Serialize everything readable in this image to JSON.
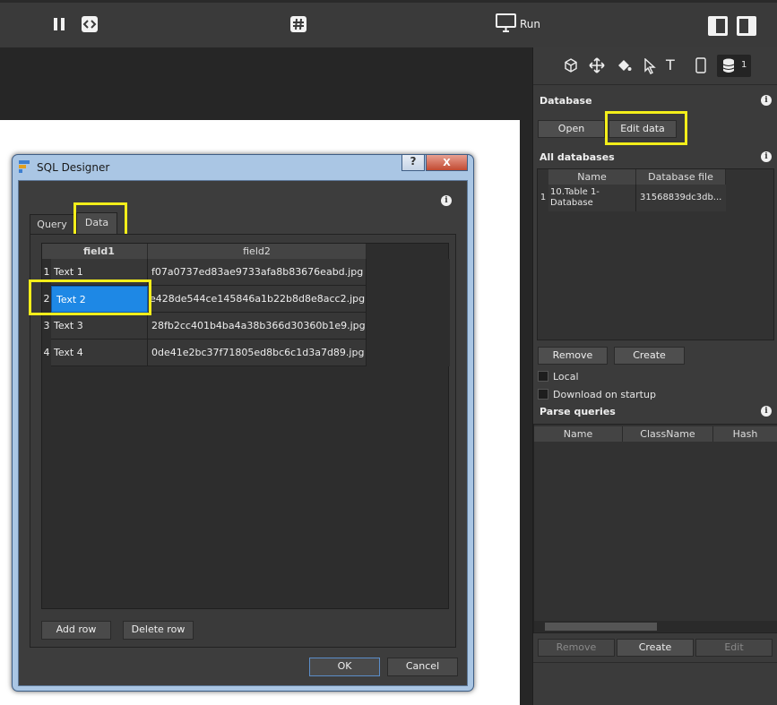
{
  "toolbar": {
    "pause_icon": "pause-icon",
    "code_icon": "code-icon",
    "hash_icon": "hash-icon",
    "run_label": "Run",
    "monitor_icon": "monitor-icon",
    "layout_left_icon": "layout-left-icon",
    "layout_right_icon": "layout-right-icon"
  },
  "panel": {
    "tools": [
      "cube-icon",
      "move-icon",
      "paint-bucket-icon",
      "pointer-icon",
      "text-icon",
      "phone-icon",
      "database-icon"
    ],
    "database_badge": "1",
    "database_title": "Database",
    "open_label": "Open",
    "edit_data_label": "Edit data",
    "all_databases_title": "All databases",
    "db_columns": [
      "Name",
      "Database file"
    ],
    "db_rows": [
      {
        "index": "1",
        "name": "10.Table 1-Database",
        "file": "31568839dc3db..."
      }
    ],
    "remove_label": "Remove",
    "create_label": "Create",
    "local_label": "Local",
    "download_label": "Download on startup",
    "parse_queries_title": "Parse queries",
    "pq_columns": [
      "Name",
      "ClassName",
      "Hash"
    ],
    "pq_remove_label": "Remove",
    "pq_create_label": "Create",
    "pq_edit_label": "Edit"
  },
  "dialog": {
    "title": "SQL Designer",
    "help_label": "?",
    "close_label": "X",
    "tabs": [
      "Query",
      "Data"
    ],
    "columns": [
      "field1",
      "field2"
    ],
    "rows": [
      {
        "index": "1",
        "field1": "Text 1",
        "field2": "f07a0737ed83ae9733afa8b83676eabd.jpg"
      },
      {
        "index": "2",
        "field1": "Text 2",
        "field2": "e428de544ce145846a1b22b8d8e8acc2.jpg"
      },
      {
        "index": "3",
        "field1": "Text 3",
        "field2": "28fb2cc401b4ba4a38b366d30360b1e9.jpg"
      },
      {
        "index": "4",
        "field1": "Text 4",
        "field2": "0de41e2bc37f71805ed8bc6c1d3a7d89.jpg"
      }
    ],
    "add_row_label": "Add row",
    "delete_row_label": "Delete row",
    "ok_label": "OK",
    "cancel_label": "Cancel"
  },
  "colors": {
    "highlight": "#f3ee1a",
    "selection": "#1e88e5"
  }
}
